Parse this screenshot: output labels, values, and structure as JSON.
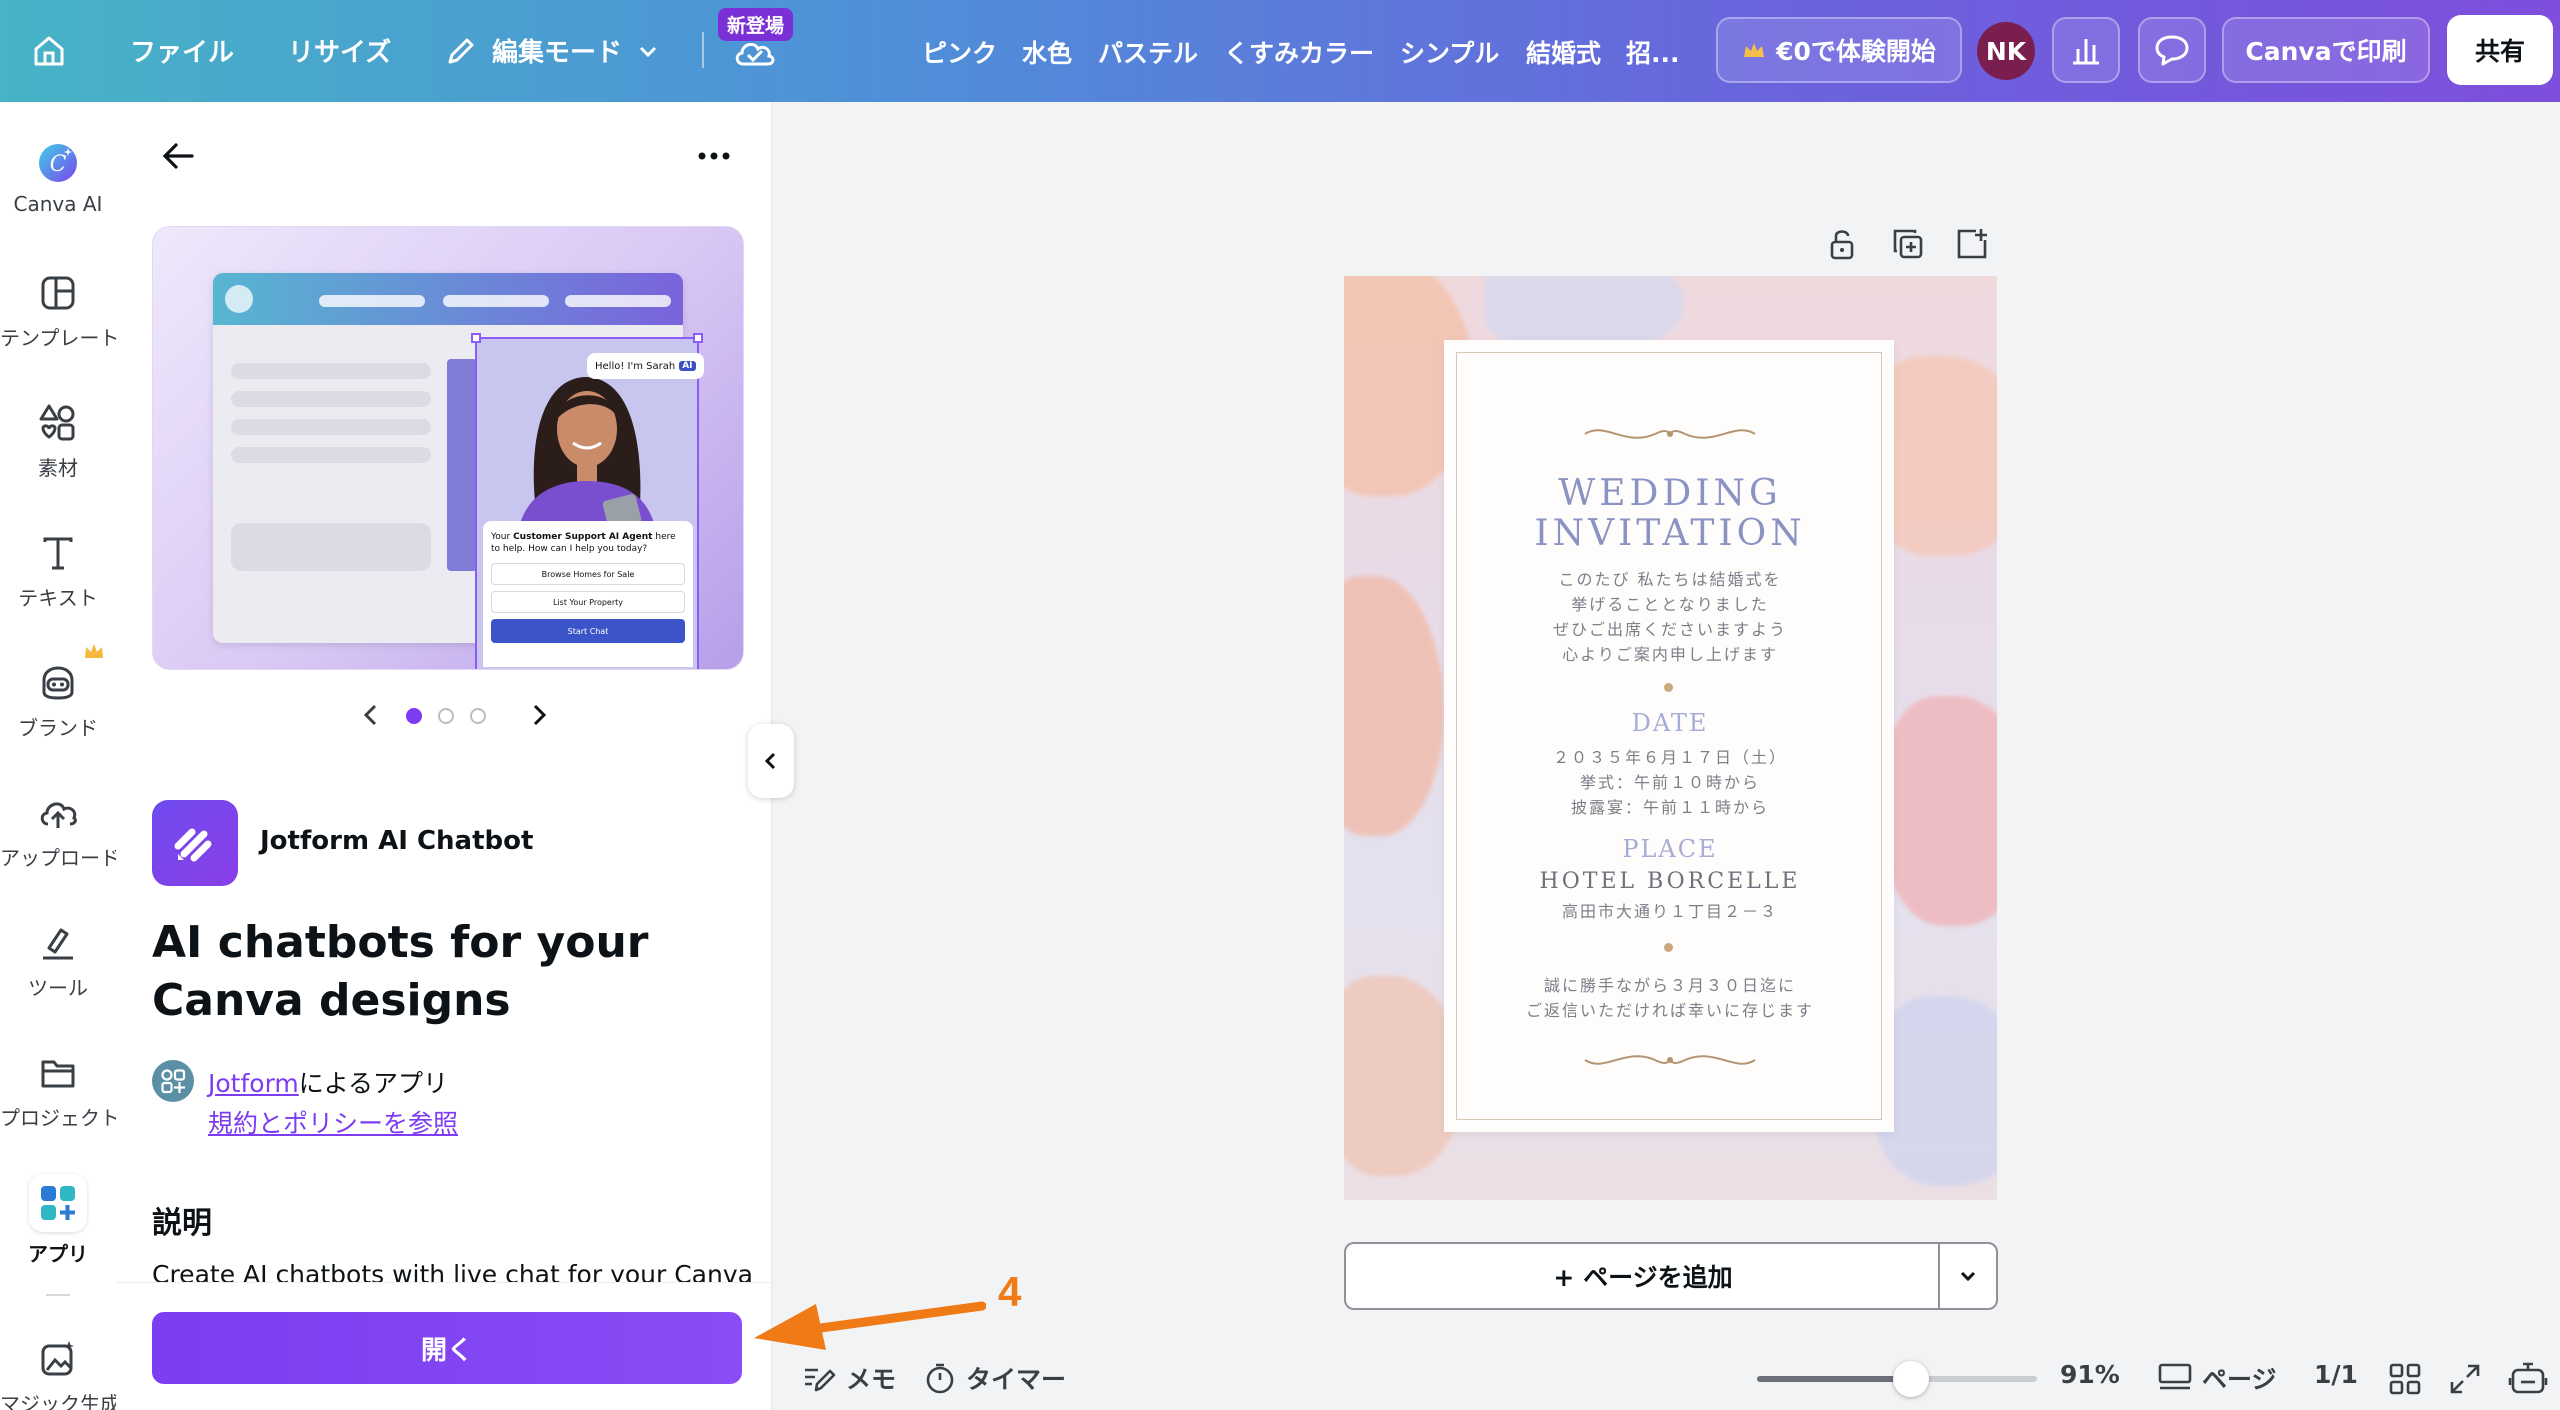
{
  "topbar": {
    "file": "ファイル",
    "resize": "リサイズ",
    "edit_mode": "編集モード",
    "new_badge": "新登場",
    "keywords": [
      "ピンク",
      "水色",
      "パステル",
      "くすみカラー",
      "シンプル",
      "結婚式",
      "招..."
    ],
    "trial": "€0で体験開始",
    "avatar": "NK",
    "print": "Canvaで印刷",
    "share": "共有"
  },
  "rail": [
    {
      "label": "Canva AI",
      "icon": "canva-ai-icon"
    },
    {
      "label": "テンプレート",
      "icon": "template-icon"
    },
    {
      "label": "素材",
      "icon": "elements-icon"
    },
    {
      "label": "テキスト",
      "icon": "text-icon"
    },
    {
      "label": "ブランド",
      "icon": "brand-icon"
    },
    {
      "label": "アップロード",
      "icon": "upload-icon"
    },
    {
      "label": "ツール",
      "icon": "tools-icon"
    },
    {
      "label": "プロジェクト",
      "icon": "folder-icon"
    },
    {
      "label": "アプリ",
      "icon": "apps-icon"
    },
    {
      "label": "マジック生成",
      "icon": "magic-icon"
    }
  ],
  "panel": {
    "hero": {
      "chat_greeting": "Hello! I'm Sarah",
      "chat_badge": "AI",
      "chat_text_pre": "Your ",
      "chat_text_bold": "Customer Support AI Agent",
      "chat_text_post": " here to help. How can I help you today?",
      "option1": "Browse Homes for Sale",
      "option2": "List Your Property",
      "cta": "Start Chat"
    },
    "app_name": "Jotform AI Chatbot",
    "app_title": "AI chatbots for your Canva designs",
    "developer": "Jotform",
    "developer_suffix": "によるアプリ",
    "policy_link": "規約とポリシーを参照",
    "description_heading": "説明",
    "description": "Create AI chatbots with live chat for your Canva designs",
    "open_button": "開く",
    "carousel_active": 0
  },
  "invitation": {
    "title_line1": "WEDDING",
    "title_line2": "INVITATION",
    "intro": [
      "このたび 私たちは結婚式を",
      "挙げることとなりました",
      "ぜひご出席くださいますよう",
      "心よりご案内申し上げます"
    ],
    "date_heading": "DATE",
    "date_lines": [
      "２０３５年６月１７日（土）",
      "挙式：午前１０時から",
      "披露宴：午前１１時から"
    ],
    "place_heading": "PLACE",
    "hotel": "HOTEL BORCELLE",
    "address": "高田市大通り１丁目２－３",
    "closing": [
      "誠に勝手ながら３月３０日迄に",
      "ご返信いただければ幸いに存じます"
    ]
  },
  "canvas": {
    "add_page": "+ ページを追加"
  },
  "bottombar": {
    "memo": "メモ",
    "timer": "タイマー",
    "zoom": "91%",
    "zoom_value": 0.55,
    "pages_label": "ページ",
    "page_count": "1/1"
  },
  "annotation": {
    "step": "4",
    "color": "#f07a16"
  },
  "colors": {
    "accent": "#7d3cf2",
    "avatar_bg": "#7a1e4f"
  }
}
